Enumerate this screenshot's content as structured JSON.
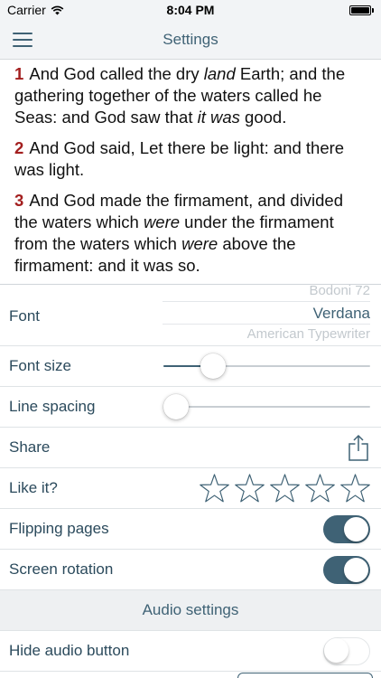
{
  "status_bar": {
    "carrier": "Carrier",
    "time": "8:04 PM",
    "battery_level": 1.0
  },
  "nav": {
    "title": "Settings"
  },
  "reader": {
    "verses": [
      {
        "number": "1",
        "parts": [
          {
            "text": " And God called the dry ",
            "italic": false
          },
          {
            "text": "land",
            "italic": true
          },
          {
            "text": " Earth; and the gathering together of the waters called he Seas: and God saw that ",
            "italic": false
          },
          {
            "text": "it was",
            "italic": true
          },
          {
            "text": " good.",
            "italic": false
          }
        ]
      },
      {
        "number": "2",
        "parts": [
          {
            "text": " And God said, Let there be light: and there was light.",
            "italic": false
          }
        ]
      },
      {
        "number": "3",
        "parts": [
          {
            "text": " And God made the firmament, and divided the waters which ",
            "italic": false
          },
          {
            "text": "were",
            "italic": true
          },
          {
            "text": " under the firmament from the waters which ",
            "italic": false
          },
          {
            "text": "were",
            "italic": true
          },
          {
            "text": " above the firmament: and it was so.",
            "italic": false
          }
        ]
      }
    ]
  },
  "settings": {
    "font": {
      "label": "Font",
      "options": [
        "Bodoni 72",
        "Verdana",
        "American Typewriter"
      ],
      "selected": "Verdana"
    },
    "font_size": {
      "label": "Font size",
      "value": 0.24
    },
    "line_spacing": {
      "label": "Line spacing",
      "value": 0.06
    },
    "share": {
      "label": "Share",
      "icon": "share-icon"
    },
    "rating": {
      "label": "Like it?",
      "stars": 5,
      "filled": 0,
      "icon": "star-icon"
    },
    "flipping_pages": {
      "label": "Flipping pages",
      "on": true
    },
    "screen_rotation": {
      "label": "Screen rotation",
      "on": true
    },
    "audio_section": {
      "title": "Audio settings"
    },
    "hide_audio": {
      "label": "Hide audio button",
      "on": false
    }
  },
  "colors": {
    "accent": "#3f6275",
    "verse_number": "#a31f1f",
    "header_bg": "#f2f4f6"
  }
}
